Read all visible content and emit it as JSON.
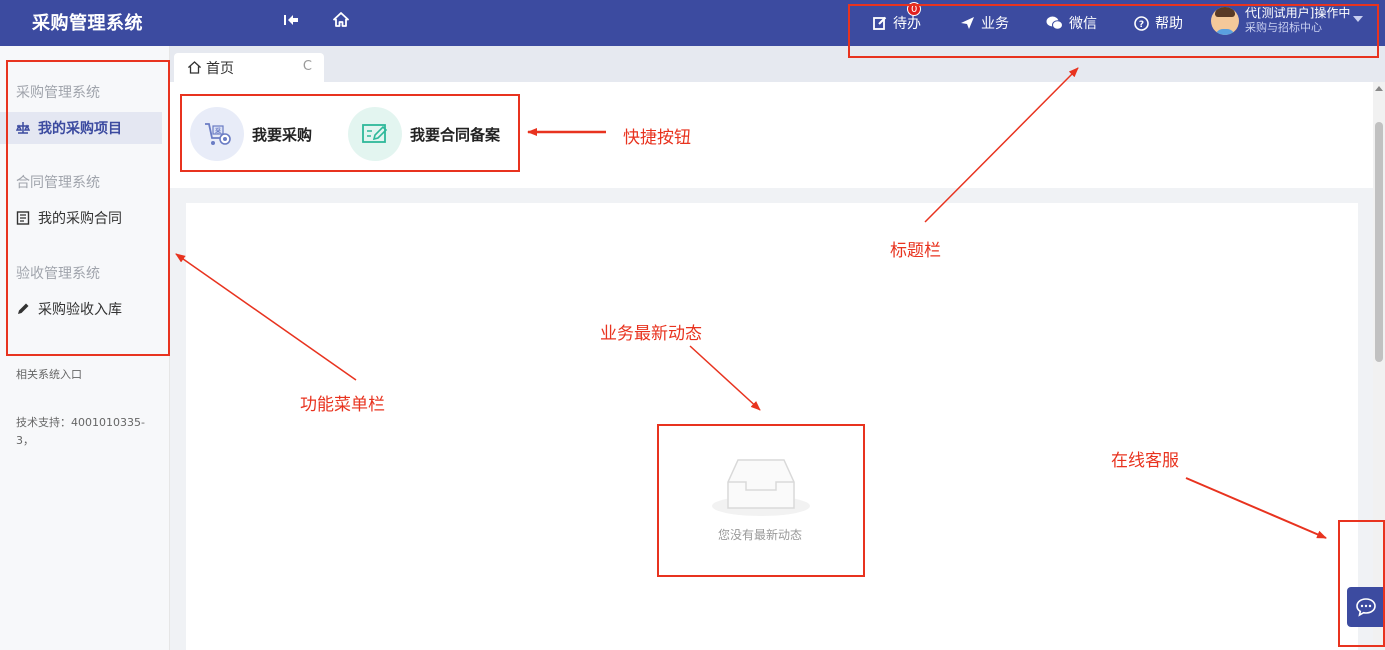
{
  "header": {
    "brand": "采购管理系统",
    "todo_label": "待办",
    "todo_badge": "0",
    "business_label": "业务",
    "wechat_label": "微信",
    "help_label": "帮助",
    "user_name": "代[测试用户]操作中",
    "user_org": "采购与招标中心"
  },
  "sidebar": {
    "groups": [
      {
        "title": "采购管理系统",
        "item": "我的采购项目"
      },
      {
        "title": "合同管理系统",
        "item": "我的采购合同"
      },
      {
        "title": "验收管理系统",
        "item": "采购验收入库"
      }
    ],
    "related": "相关系统入口",
    "support": "技术支持：4001010335-3，"
  },
  "tabs": {
    "home": "首页"
  },
  "quick": {
    "purchase": "我要采购",
    "contract": "我要合同备案"
  },
  "feed": {
    "empty": "您没有最新动态"
  },
  "annotations": {
    "shortcut": "快捷按钮",
    "titlebar": "标题栏",
    "feed": "业务最新动态",
    "menu": "功能菜单栏",
    "service": "在线客服"
  },
  "colors": {
    "header": "#3c4ba0",
    "annotation": "#e8331f"
  },
  "icons": [
    "collapse-icon",
    "home-icon",
    "edit-icon",
    "send-icon",
    "wechat-icon",
    "help-icon",
    "avatar",
    "scale-icon",
    "document-icon",
    "pencil-icon",
    "refresh-icon",
    "cart-icon",
    "contract-edit-icon",
    "empty-inbox-icon",
    "chat-icon"
  ]
}
